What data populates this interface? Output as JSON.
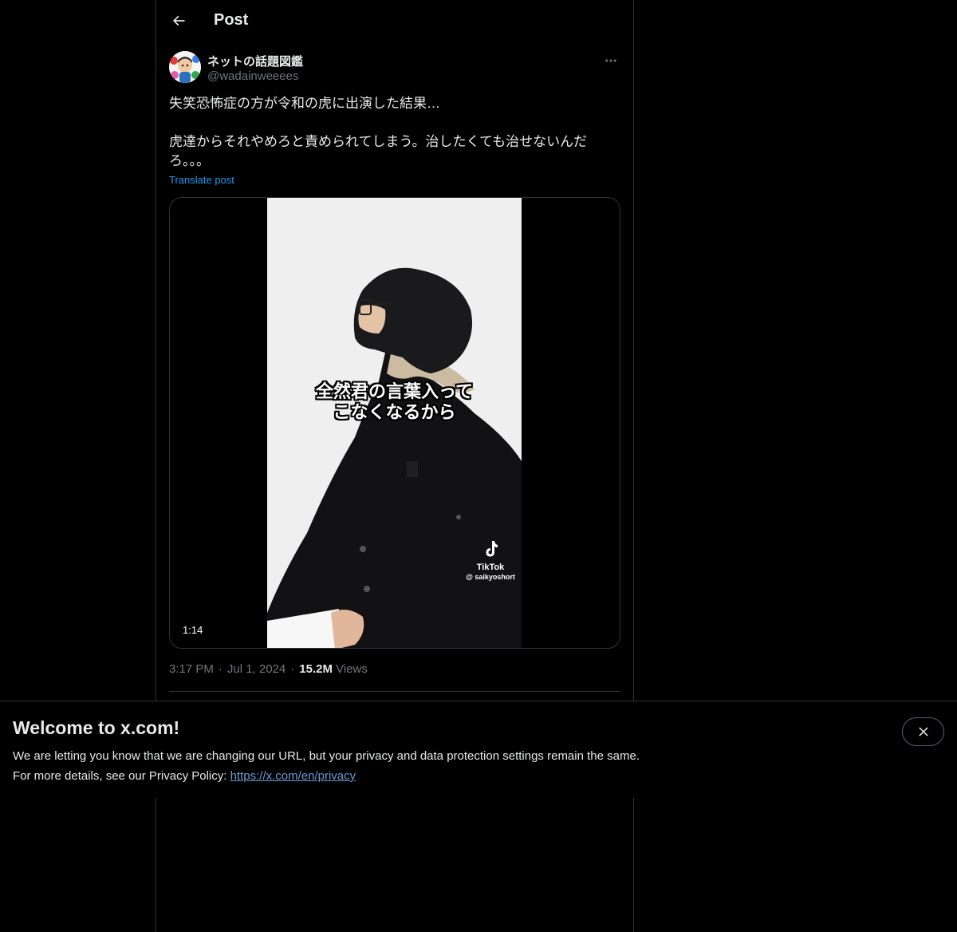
{
  "header": {
    "title": "Post",
    "back_icon": "arrow-left-icon"
  },
  "post": {
    "author": {
      "display_name": "ネットの話題図鑑",
      "handle": "@wadainweeees"
    },
    "text_lines": [
      "失笑恐怖症の方が令和の虎に出演した結果…",
      "虎達からそれやめろと責められてしまう。治したくても治せないんだ",
      "ろ。。。"
    ],
    "translate_label": "Translate post",
    "media": {
      "caption_line1": "全然君の言葉入って",
      "caption_line2": "こなくなるから",
      "watermark_brand": "TikTok",
      "watermark_user": "@ saikyoshort",
      "duration": "1:14"
    },
    "time": "3:17 PM",
    "date": "Jul 1, 2024",
    "views_count": "15.2M",
    "views_label": "Views",
    "separator": "·"
  },
  "banner": {
    "title": "Welcome to x.com!",
    "line1": "We are letting you know that we are changing our URL, but your privacy and data protection settings remain the same.",
    "line2_prefix": "For more details, see our Privacy Policy: ",
    "link": "https://x.com/en/privacy",
    "close_icon": "close-icon"
  },
  "colors": {
    "background": "#000000",
    "text_primary": "#e7e9ea",
    "text_secondary": "#71767b",
    "accent": "#1d9bf0",
    "border": "#2f3336"
  }
}
